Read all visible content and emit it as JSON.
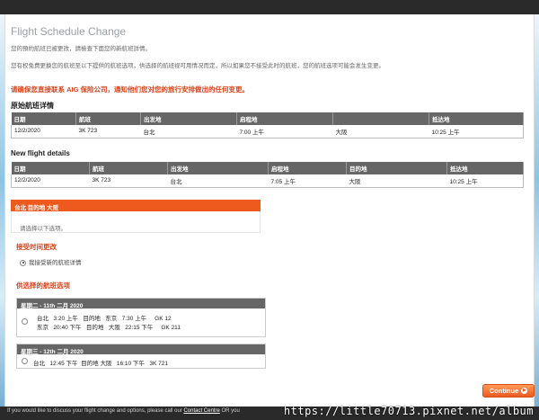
{
  "header": {
    "title": "Flight Schedule Change"
  },
  "intro": {
    "line1": "您的預約航班已被更改，請檢查下面您的新航班詳情。",
    "line2": "您有权免费更换您的航班至以下提供的航班选项，供选择的航班视可用情况而定，所以如果您不接受此时的航班，您的航班选项可能会发生变更。"
  },
  "aig_notice": "请确保您直接联系 AIG 保险公司，通知他们您对您的旅行安排做出的任何变更。",
  "original": {
    "title": "原始航班详情",
    "headers": [
      "日期",
      "航班",
      "出发地",
      "启程地",
      "",
      "抵达地"
    ],
    "row": [
      "12/2/2020",
      "3K 723",
      "台北",
      "7:00 上午",
      "大阪",
      "10:25 上午"
    ]
  },
  "new_flight": {
    "title": "New flight details",
    "headers": [
      "日期",
      "航班",
      "出发地",
      "启程地",
      "目的地",
      "抵达地"
    ],
    "row": [
      "12/2/2020",
      "3K 723",
      "台北",
      "7:05 上午",
      "大阪",
      "10:25 上午"
    ]
  },
  "route": {
    "label": "台北 目的地 大阪",
    "hint": "请选择以下选项。"
  },
  "accept": {
    "title": "接受时间更改",
    "option": "我接受新的航班详情"
  },
  "options": {
    "title": "供选择的航班选项",
    "blocks": [
      {
        "header": "星期二 - 11th 二月 2020",
        "segments": [
          {
            "from": "台北",
            "dep": "3:20 上午",
            "to_label": "目的地",
            "to": "东京",
            "arr": "7:30 上午",
            "flight": "GK 12"
          },
          {
            "from": "东京",
            "dep": "20:40 下午",
            "to_label": "目的地",
            "to": "大阪",
            "arr": "22:15 下午",
            "flight": "GK 211"
          }
        ]
      },
      {
        "header": "星期三 - 12th 二月 2020",
        "segments": [
          {
            "from": "台北",
            "dep": "12:45 下午",
            "to_label": "目的地",
            "to": "大阪",
            "arr": "16:10 下午",
            "flight": "3K 721"
          }
        ]
      }
    ]
  },
  "continue_label": "Continue",
  "footer": {
    "text": "If you would like to discuss your flight change and options, please call our",
    "link": "Contact Centre",
    "tail": "OR you"
  },
  "watermark": "https://little70713.pixnet.net/album",
  "colors": {
    "accent": "#ee5a1e",
    "header_gray": "#666666",
    "footer_bg": "#2a2a2a"
  }
}
